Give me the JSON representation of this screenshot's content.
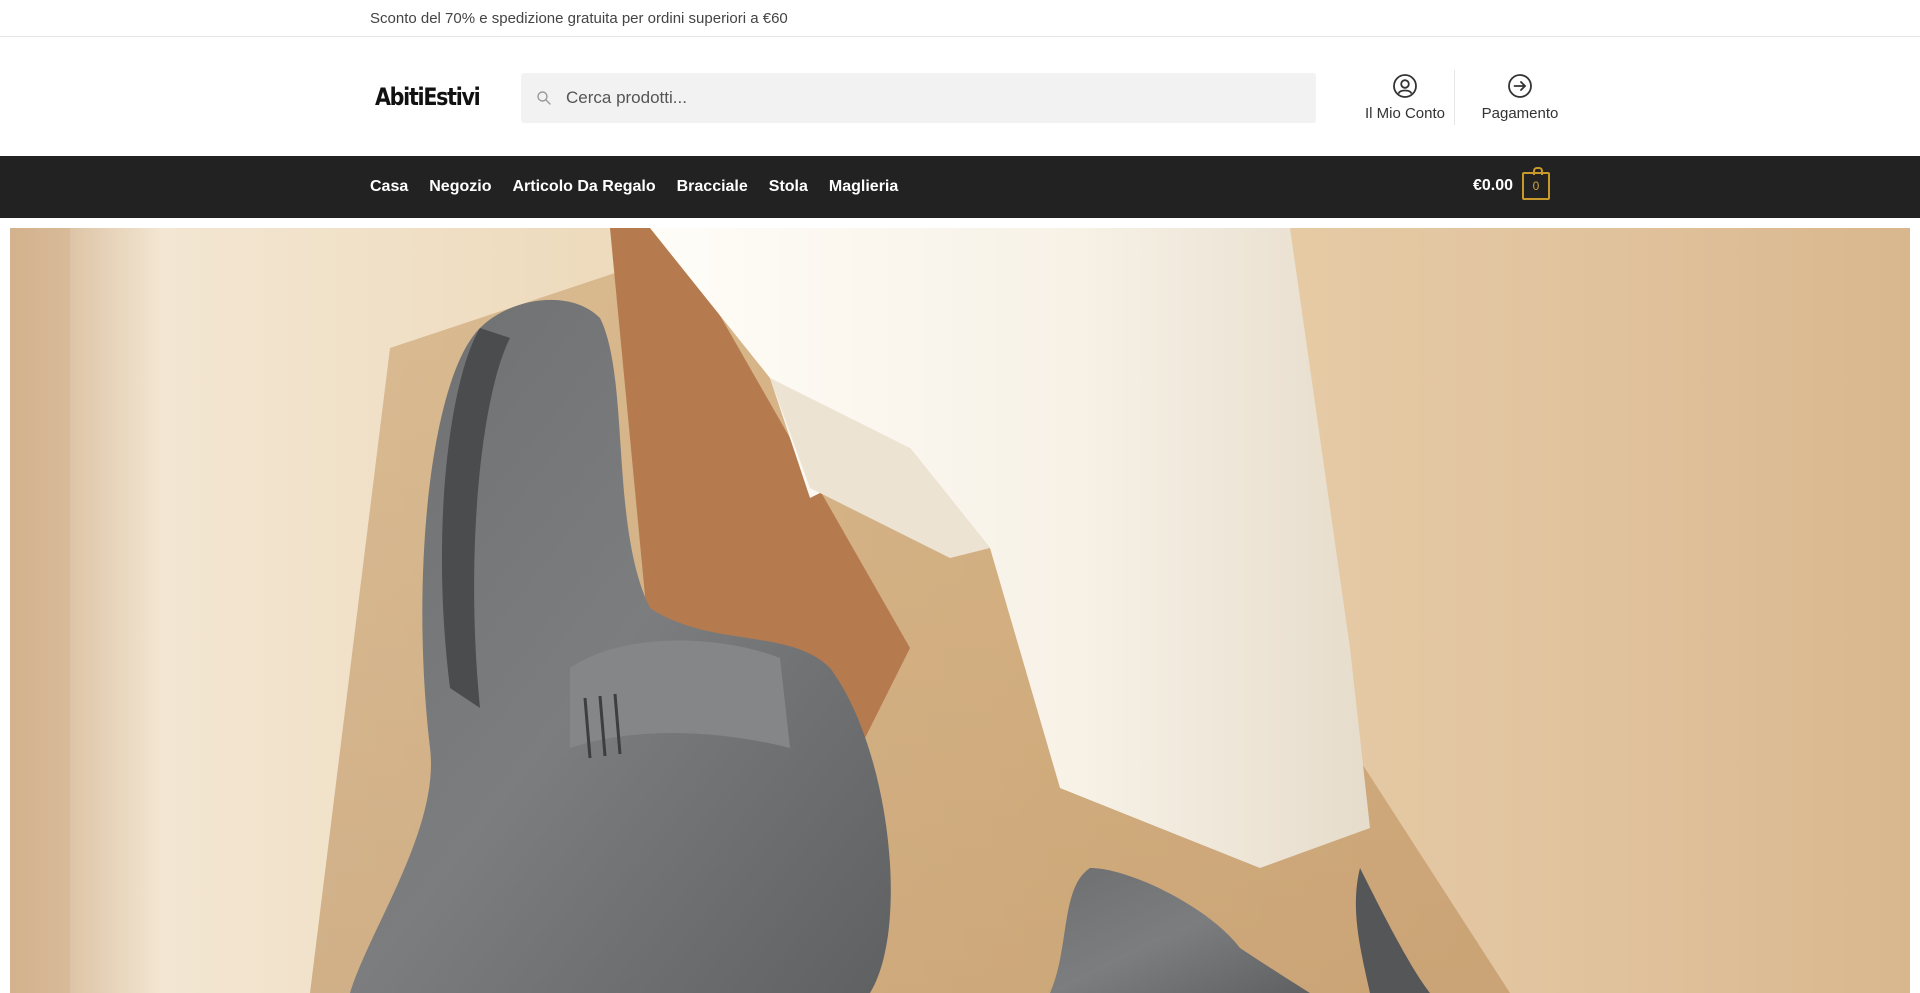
{
  "topbar": {
    "promo": "Sconto del 70% e spedizione gratuita per ordini superiori a €60"
  },
  "header": {
    "logo": "AbitiEstivi",
    "search": {
      "placeholder": "Cerca prodotti...",
      "value": ""
    },
    "account_label": "Il Mio Conto",
    "checkout_label": "Pagamento"
  },
  "nav": {
    "items": [
      {
        "label": "Casa"
      },
      {
        "label": "Negozio"
      },
      {
        "label": "Articolo Da Regalo"
      },
      {
        "label": "Bracciale"
      },
      {
        "label": "Stola"
      },
      {
        "label": "Maglieria"
      }
    ],
    "cart_total": "€0.00",
    "cart_count": "0"
  },
  "colors": {
    "nav_bg": "#222222",
    "cart_accent": "#c8992a"
  },
  "icons": {
    "search": "search-icon",
    "account": "user-circle-icon",
    "checkout": "arrow-right-circle-icon",
    "cart": "shopping-bag-icon"
  }
}
